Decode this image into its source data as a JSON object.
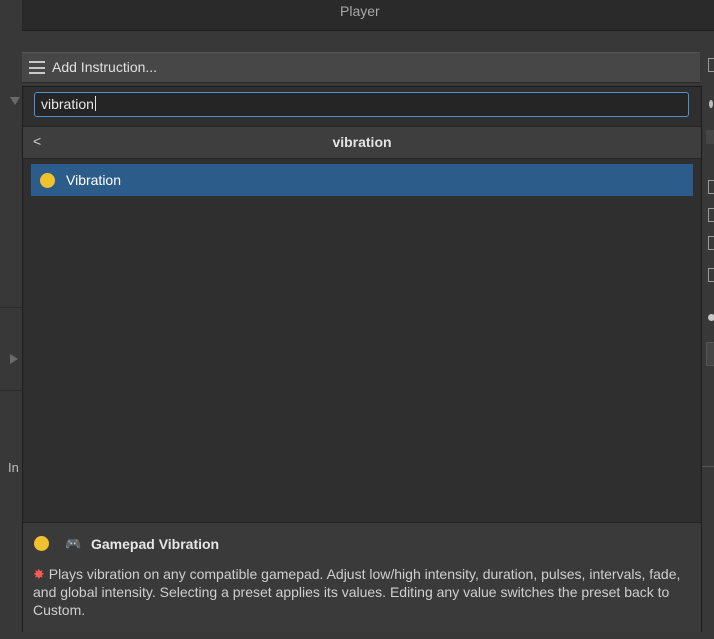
{
  "background": {
    "field_value": "Player",
    "side_label": "In"
  },
  "add_instruction": {
    "label": "Add Instruction..."
  },
  "search": {
    "value": "vibration"
  },
  "results_header": {
    "back_glyph": "<",
    "title": "vibration"
  },
  "results": [
    {
      "label": "Vibration",
      "icon": "yellow-dot-icon",
      "color": "#f2c12e",
      "selected": true
    }
  ],
  "description": {
    "icon": "gamepad-icon",
    "icon_glyph": "🎮",
    "title": "Gamepad Vibration",
    "bullet_glyph": "✸",
    "text": "Plays vibration on any compatible gamepad. Adjust low/high intensity, duration, pulses, intervals, fade, and global intensity. Selecting a preset applies its values. Editing any value switches the preset back to Custom."
  },
  "colors": {
    "selection": "#2c5d8a",
    "focus_border": "#4d90d6",
    "dot": "#f2c12e"
  }
}
